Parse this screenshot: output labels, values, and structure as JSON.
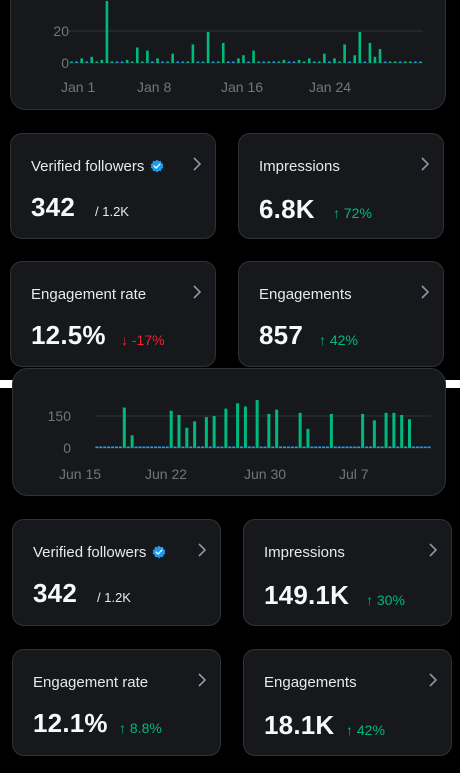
{
  "top": {
    "chart_data": {
      "type": "bar",
      "y_ticks": [
        "20",
        "0"
      ],
      "x_ticks": [
        "Jan 1",
        "Jan 8",
        "Jan 16",
        "Jan 24"
      ],
      "values": [
        1,
        0,
        3,
        0,
        4,
        1,
        2,
        40,
        1,
        0,
        0,
        2,
        1,
        10,
        1,
        8,
        0,
        3,
        0,
        1,
        6,
        0,
        0,
        1,
        12,
        0,
        1,
        20,
        0,
        1,
        13,
        0,
        0,
        3,
        5,
        0,
        8,
        1,
        0,
        1,
        0,
        1,
        2,
        0,
        0,
        2,
        1,
        3,
        0,
        1,
        6,
        0,
        3,
        1,
        12,
        0,
        5,
        20,
        0,
        13,
        4,
        9,
        0,
        1,
        1,
        0,
        1,
        1,
        0,
        1
      ],
      "baseline": 0,
      "bar_color": "#00ba7c"
    },
    "cards": [
      {
        "title": "Verified followers",
        "value": "342",
        "suffix": "/ 1.2K",
        "verified": true
      },
      {
        "title": "Impressions",
        "value": "6.8K",
        "delta": "↑ 72%",
        "trend": "up"
      },
      {
        "title": "Engagement rate",
        "value": "12.5%",
        "delta": "↓ -17%",
        "trend": "down"
      },
      {
        "title": "Engagements",
        "value": "857",
        "delta": "↑ 42%",
        "trend": "up"
      }
    ]
  },
  "bottom": {
    "chart_data": {
      "type": "bar",
      "y_ticks": [
        "150",
        "0"
      ],
      "x_ticks": [
        "Jun 15",
        "Jun 22",
        "Jun 30",
        "Jul 7"
      ],
      "values": [
        0,
        0,
        0,
        0,
        0,
        0,
        0,
        190,
        0,
        60,
        0,
        0,
        0,
        0,
        0,
        0,
        0,
        0,
        0,
        175,
        0,
        155,
        0,
        95,
        0,
        125,
        0,
        0,
        145,
        0,
        150,
        0,
        0,
        185,
        0,
        0,
        210,
        0,
        195,
        0,
        0,
        225,
        0,
        0,
        160,
        0,
        180,
        0,
        0,
        0,
        0,
        0,
        165,
        0,
        90,
        0,
        0,
        0,
        0,
        0,
        160,
        0,
        0,
        0,
        0,
        0,
        0,
        0,
        160,
        0,
        0,
        130,
        0,
        0,
        165,
        0,
        165,
        0,
        155,
        0,
        135,
        0,
        0,
        0,
        0,
        0
      ],
      "baseline": 0,
      "bar_color": "#00ba7c"
    },
    "cards": [
      {
        "title": "Verified followers",
        "value": "342",
        "suffix": "/ 1.2K",
        "verified": true
      },
      {
        "title": "Impressions",
        "value": "149.1K",
        "delta": "↑ 30%",
        "trend": "up"
      },
      {
        "title": "Engagement rate",
        "value": "12.1%",
        "delta": "↑ 8.8%",
        "trend": "up"
      },
      {
        "title": "Engagements",
        "value": "18.1K",
        "delta": "↑ 42%",
        "trend": "up"
      }
    ]
  },
  "icons": {
    "verified": "verified-badge-icon",
    "chevron": "chevron-right-icon"
  }
}
